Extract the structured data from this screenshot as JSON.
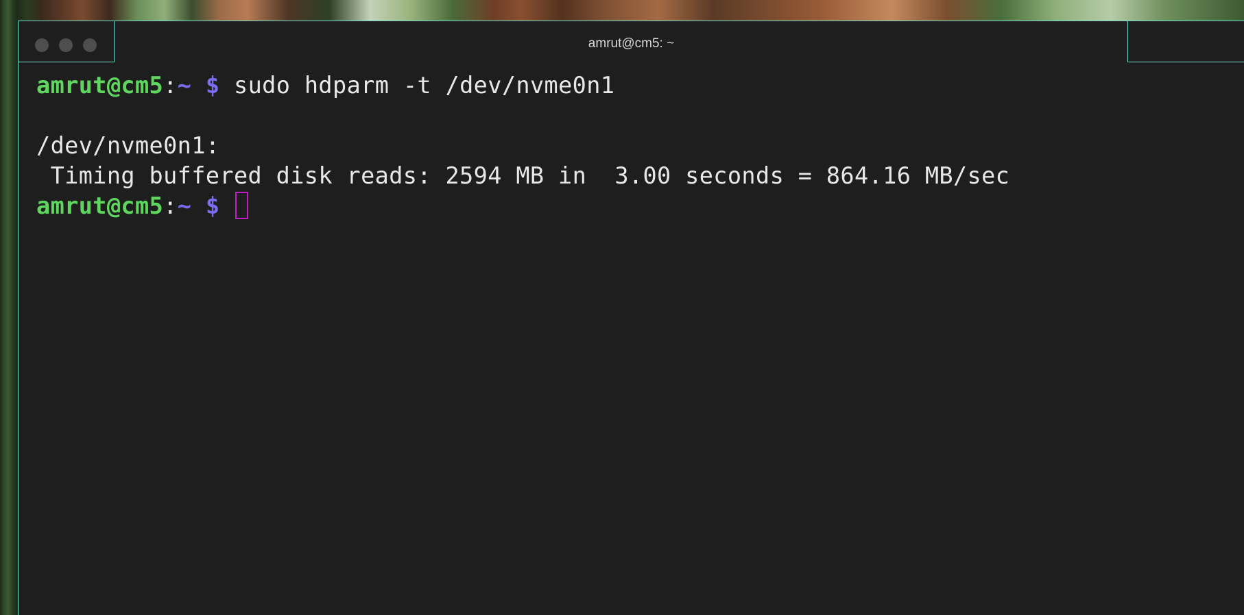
{
  "window": {
    "title": "amrut@cm5: ~"
  },
  "terminal": {
    "prompt": {
      "user_host": "amrut@cm5",
      "separator": ":",
      "path": "~",
      "symbol": "$"
    },
    "command": "sudo hdparm -t /dev/nvme0n1",
    "output": [
      "/dev/nvme0n1:",
      " Timing buffered disk reads: 2594 MB in  3.00 seconds = 864.16 MB/sec"
    ]
  },
  "colors": {
    "background": "#1e1e1e",
    "user_host": "#5fd75f",
    "path_and_symbol": "#7b6cf0",
    "text": "#e8e8e8",
    "cursor": "#c21cc8",
    "window_border": "#6fe0c8"
  }
}
